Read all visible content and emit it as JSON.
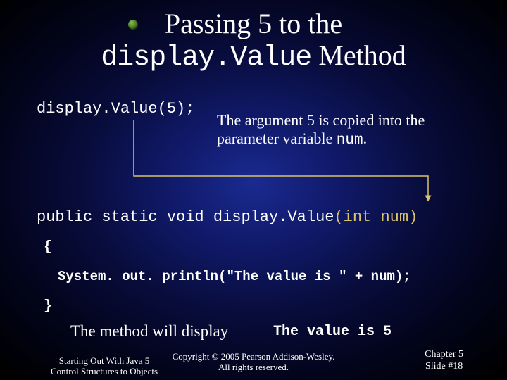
{
  "title": {
    "line1": "Passing 5 to the",
    "code": "display.Value",
    "line2_suffix": " Method"
  },
  "call_code": "display.Value(5);",
  "caption": {
    "text_pre": "The argument 5 is copied into the",
    "text_mid": "parameter variable ",
    "code": "num",
    "text_post": "."
  },
  "signature_parts": {
    "pre": "public static void display.Value",
    "paren_open": "(",
    "param": "int num",
    "paren_close": ")"
  },
  "brace_open": "{",
  "body_line": "System. out. println(\"The value is \" + num);",
  "brace_close": "}",
  "method_will": "The method will display",
  "value_out": "The value is 5",
  "footer": {
    "left_line1": "Starting Out With Java 5",
    "left_line2": "Control Structures to Objects",
    "center_line1": "Copyright © 2005 Pearson Addison-Wesley.",
    "center_line2": "All rights reserved.",
    "right_line1": "Chapter 5",
    "right_line2": "Slide #18"
  },
  "colors": {
    "accent": "#d8c46a"
  }
}
